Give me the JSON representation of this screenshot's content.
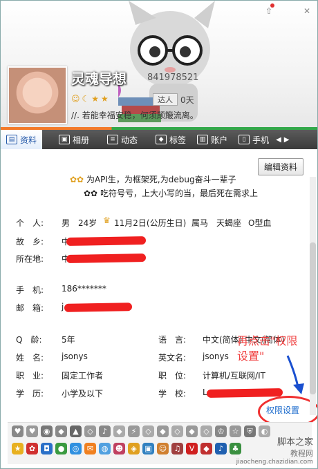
{
  "window": {
    "pin_icon": "pin-icon",
    "close_label": "✕"
  },
  "profile": {
    "nickname": "灵魂导想",
    "qq_number": "841978521",
    "level_label": "达人",
    "days": "0天",
    "signature": "//. 若能幸福安稳，何须颠簸流离。"
  },
  "tabs": [
    {
      "label": "资料",
      "icon": "profile-icon"
    },
    {
      "label": "相册",
      "icon": "album-icon"
    },
    {
      "label": "动态",
      "icon": "feed-icon"
    },
    {
      "label": "标签",
      "icon": "tag-icon"
    },
    {
      "label": "账户",
      "icon": "account-icon"
    },
    {
      "label": "手机",
      "icon": "phone-icon"
    }
  ],
  "edit_button": "编辑资料",
  "motto": {
    "line1": "为API生，为框架死,为debug奋斗一辈子",
    "line2": "吃符号亏，上大小写的当，最后死在需求上"
  },
  "info": {
    "personal_label": "个　人:",
    "gender": "男",
    "age": "24岁",
    "birthday": "11月2日(公历生日)",
    "zodiac": "属马",
    "constellation": "天蝎座",
    "blood": "O型血",
    "hometown_label": "故　乡:",
    "hometown_visible": "中",
    "location_label": "所在地:",
    "location_visible": "中",
    "phone_label": "手　机:",
    "phone": "186*******",
    "email_label": "邮　箱:",
    "email_visible": "j",
    "qage_label": "Q　龄:",
    "qage": "5年",
    "language_label": "语　言:",
    "language": "中文(简体) 中文(简体)",
    "name_label": "姓　名:",
    "name": "jsonys",
    "engname_label": "英文名:",
    "engname": "jsonys",
    "job_label": "职　业:",
    "job": "固定工作者",
    "position_label": "职　位:",
    "position": "计算机/互联网/IT",
    "edu_label": "学　历:",
    "edu": "小学及以下",
    "school_label": "学　校:",
    "school_visible": "L"
  },
  "permission_link": "权限设置",
  "annotation": {
    "line1": "再点击\"权限",
    "line2": "设置\""
  },
  "watermark": {
    "line1": "脚本之家",
    "line2": "教程网",
    "line3": "jiaocheng.chazidian.com"
  },
  "colors": {
    "accent": "#2358a8",
    "red": "#f02020"
  }
}
